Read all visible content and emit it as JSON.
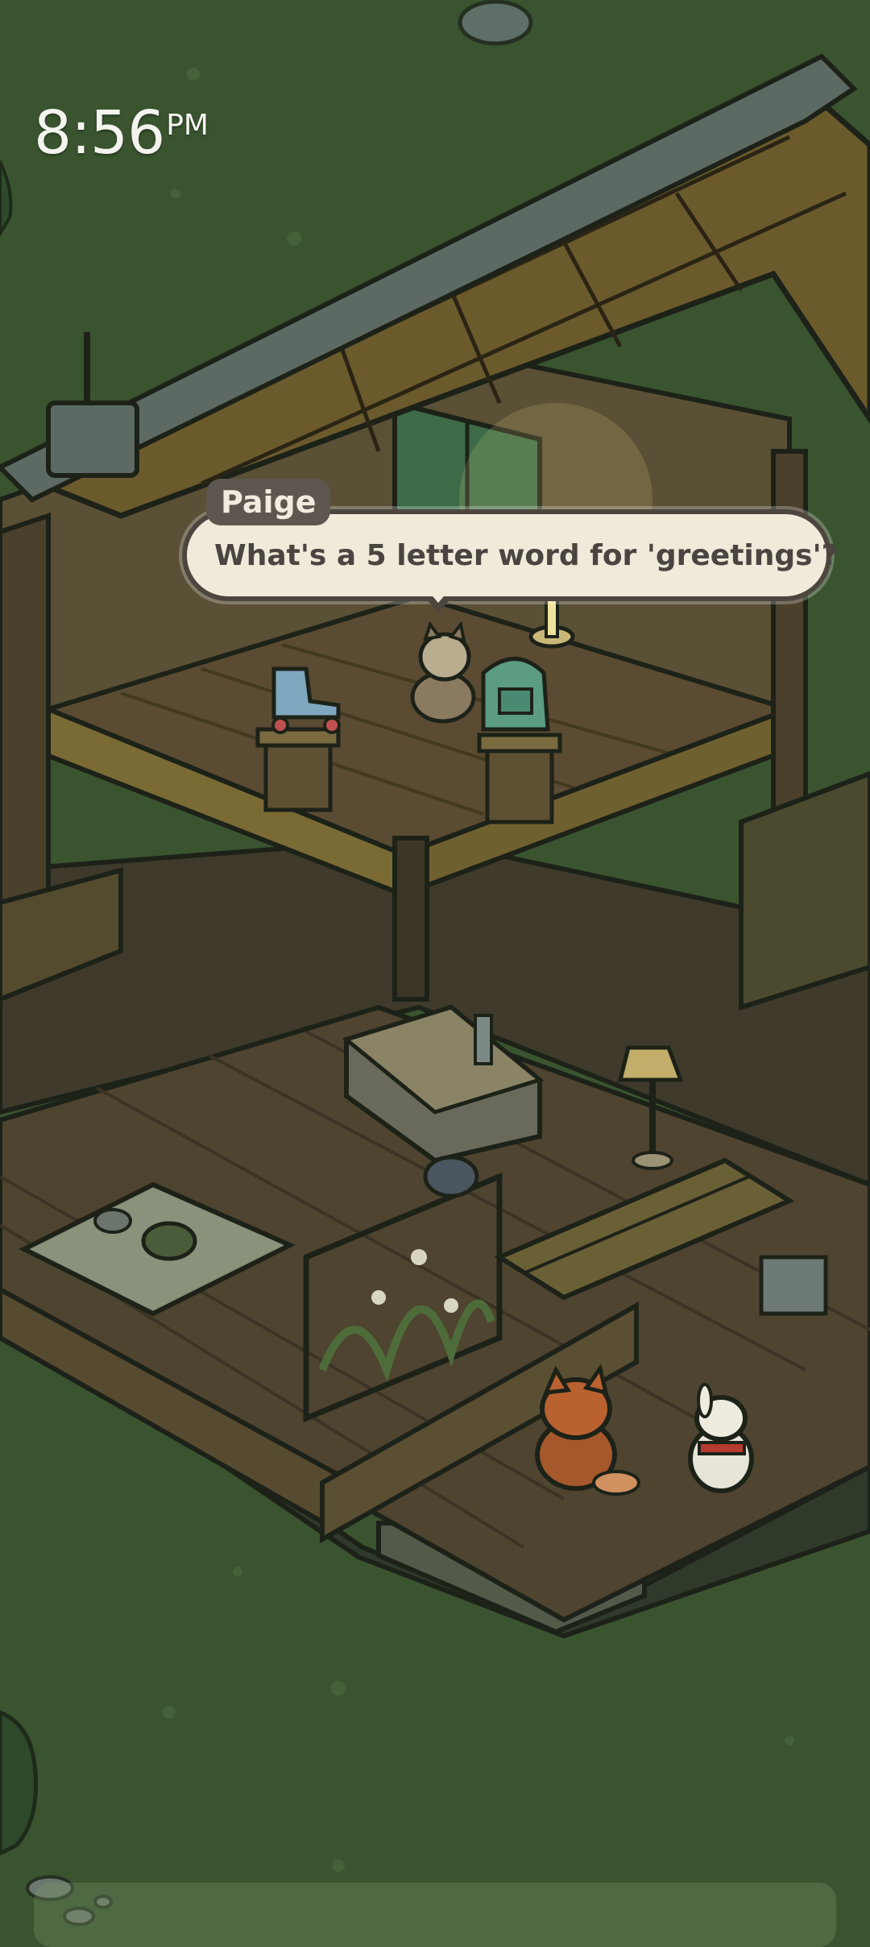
{
  "status_bar": {
    "time": "8:56",
    "ampm": "PM"
  },
  "dialogue": {
    "speaker": "Paige",
    "text": "What's a 5 letter word for 'greetings'?"
  },
  "colors": {
    "grass": "#3a5430",
    "roof": "#6b5a2c",
    "floor": "#4f4530",
    "bubble_bg": "#efead9",
    "speaker_tag_bg": "#5e5750"
  },
  "icons": {
    "characters": [
      "raccoon-character",
      "fox-character",
      "rabbit-character",
      "cat-character"
    ],
    "items": [
      "roller-skate-item",
      "backpack-item"
    ]
  }
}
